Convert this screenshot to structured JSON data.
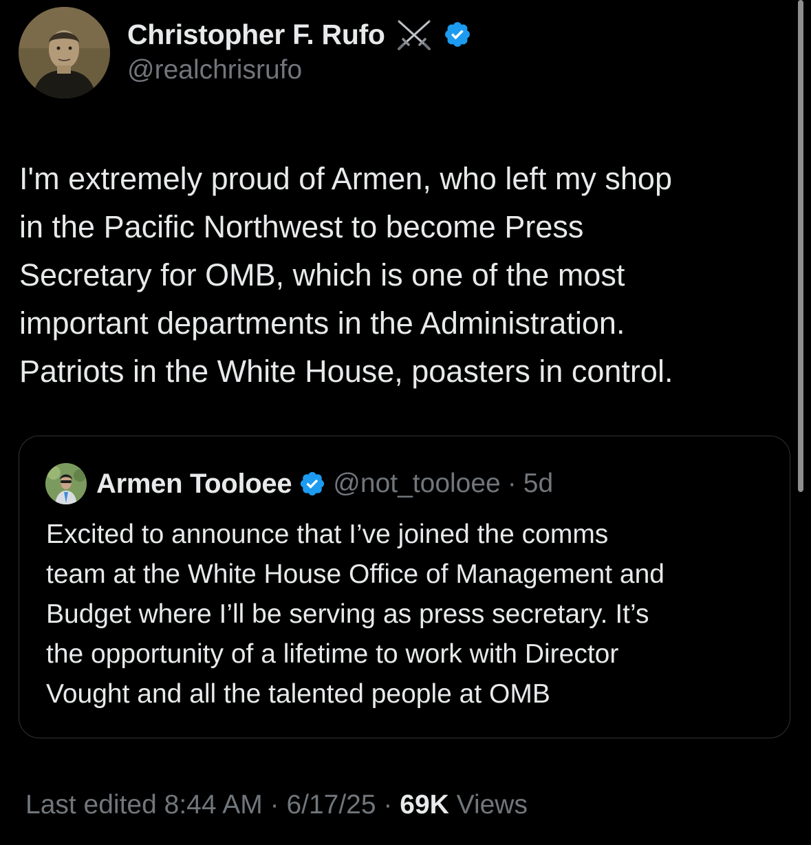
{
  "tweet": {
    "author": {
      "display_name": "Christopher F. Rufo",
      "handle": "@realchrisrufo",
      "emoji_icon": "crossed-swords-icon",
      "verified_icon": "verified-badge-icon",
      "verified_color": "#1d9bf0"
    },
    "text": "I'm extremely proud of Armen, who left my shop\nin the Pacific Northwest to become Press\nSecretary for OMB, which is one of the most\nimportant departments in the Administration.\nPatriots in the White House, poasters in control.",
    "quote": {
      "display_name": "Armen Tooloee",
      "handle": "@not_tooloee",
      "separator": "·",
      "time": "5d",
      "verified_icon": "verified-badge-icon",
      "text": "Excited to announce that I’ve joined the comms\nteam at the White House Office of Management and\nBudget where I’ll be serving as press secretary. It’s\nthe opportunity of a lifetime to work with Director\nVought and all the talented people at OMB"
    },
    "footer": {
      "edited_label": "Last edited",
      "time": "8:44 AM",
      "separator": "·",
      "date": "6/17/25",
      "views_count": "69K",
      "views_label": "Views"
    }
  },
  "colors": {
    "background": "#000000",
    "primary_text": "#e7e9ea",
    "secondary_text": "#71767b",
    "border": "#2f3336",
    "accent": "#1d9bf0"
  }
}
